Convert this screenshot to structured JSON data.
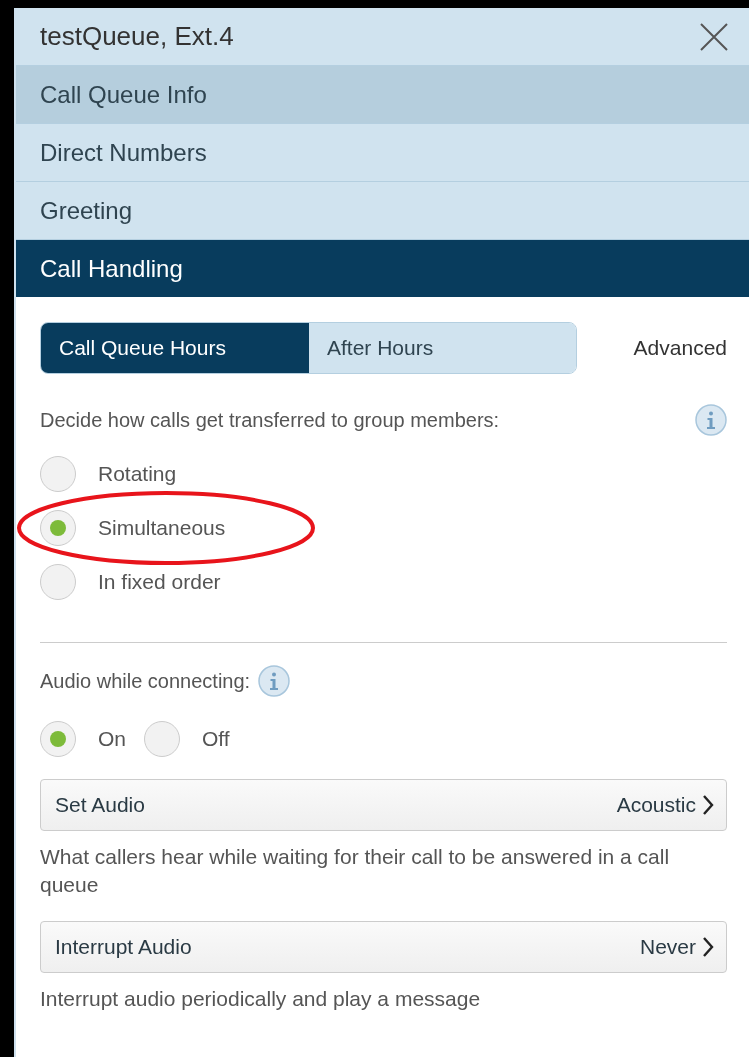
{
  "window": {
    "title": "testQueue, Ext.4"
  },
  "menu": [
    {
      "label": "Call Queue Info",
      "selected": false,
      "highlighted": true
    },
    {
      "label": "Direct Numbers",
      "selected": false,
      "highlighted": false
    },
    {
      "label": "Greeting",
      "selected": false,
      "highlighted": false
    },
    {
      "label": "Call Handling",
      "selected": true,
      "highlighted": false
    }
  ],
  "tabs": [
    {
      "label": "Call Queue Hours",
      "selected": true
    },
    {
      "label": "After Hours",
      "selected": false
    }
  ],
  "advanced_link": "Advanced",
  "transfer": {
    "prompt": "Decide how calls get transferred to group members:",
    "options": [
      {
        "label": "Rotating",
        "selected": false
      },
      {
        "label": "Simultaneous",
        "selected": true,
        "annotated": true
      },
      {
        "label": "In fixed order",
        "selected": false
      }
    ]
  },
  "audio": {
    "prompt": "Audio while connecting:",
    "options": [
      {
        "label": "On",
        "selected": true
      },
      {
        "label": "Off",
        "selected": false
      }
    ]
  },
  "settings": [
    {
      "label": "Set Audio",
      "value": "Acoustic",
      "description": "What callers hear while waiting for their call to be answered in a call queue"
    },
    {
      "label": "Interrupt Audio",
      "value": "Never",
      "description": "Interrupt audio periodically and play a message"
    }
  ]
}
